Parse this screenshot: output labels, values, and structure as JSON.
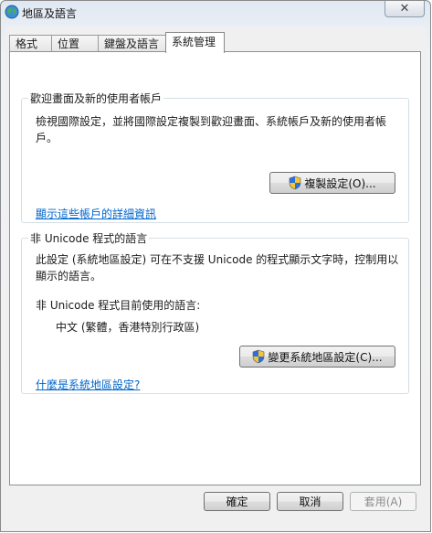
{
  "window": {
    "title": "地區及語言",
    "close_label": "✕"
  },
  "tabs": [
    {
      "label": "格式"
    },
    {
      "label": "位置"
    },
    {
      "label": "鍵盤及語言"
    },
    {
      "label": "系統管理"
    }
  ],
  "welcome": {
    "group_title": "歡迎畫面及新的使用者帳戶",
    "description_line1": "檢視國際設定，並將國際設定複製到歡迎畫面、系統帳戶及新的使用者帳",
    "description_line2": "戶。",
    "copy_button": "複製設定(O)...",
    "details_link": "顯示這些帳戶的詳細資訊"
  },
  "unicode": {
    "group_title": "非 Unicode 程式的語言",
    "description_line1": "此設定 (系統地區設定) 可在不支援 Unicode 的程式顯示文字時，控制用以",
    "description_line2": "顯示的語言。",
    "current_label": "非 Unicode 程式目前使用的語言:",
    "current_value": "中文 (繁體，香港特別行政區)",
    "change_button": "變更系統地區設定(C)...",
    "help_link": "什麼是系統地區設定?"
  },
  "footer": {
    "ok_label": "確定",
    "cancel_label": "取消",
    "apply_label": "套用(A)"
  }
}
